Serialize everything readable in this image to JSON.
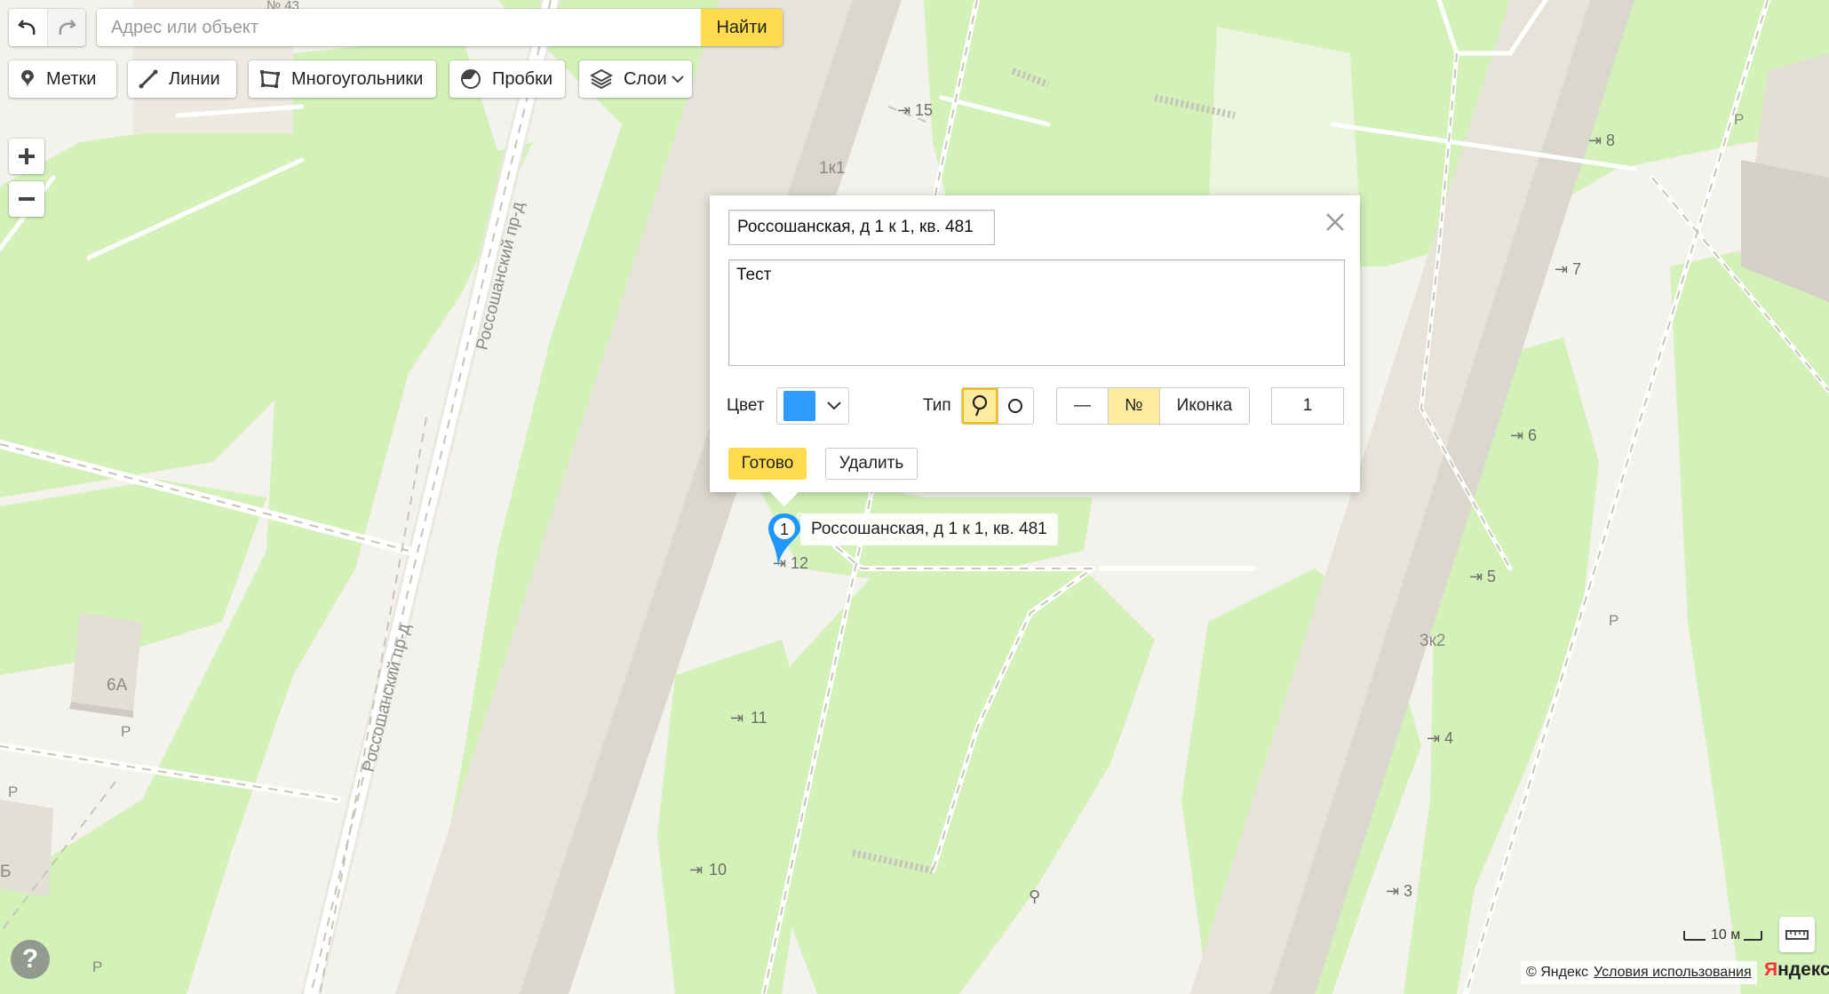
{
  "toolbar": {
    "search_placeholder": "Адрес или объект",
    "search_button": "Найти",
    "tools": [
      {
        "label": "Метки",
        "icon": "placemark-icon"
      },
      {
        "label": "Линии",
        "icon": "line-icon"
      },
      {
        "label": "Многоугольники",
        "icon": "polygon-icon"
      },
      {
        "label": "Пробки",
        "icon": "traffic-icon"
      },
      {
        "label": "Слои",
        "icon": "layers-icon"
      }
    ]
  },
  "balloon": {
    "title_value": "Россошанская, д 1 к 1, кв. 481",
    "description_value": "Тест",
    "color_label": "Цвет",
    "color_value": "#2f9bff",
    "type_label": "Тип",
    "content_options": [
      "—",
      "№",
      "Иконка"
    ],
    "selected_content": "№",
    "number_value": "1",
    "done_button": "Готово",
    "delete_button": "Удалить"
  },
  "marker": {
    "number": "1",
    "label": "Россошанская, д 1 к 1, кв. 481"
  },
  "map_labels": {
    "street_upper": "Россошанский пр-д",
    "street_lower": "Россошанский пр-д",
    "building_1k1": "1к1",
    "building_3k2": "3к2",
    "building_6a": "6А",
    "building_b": "Б",
    "top_partial": "№ 43",
    "parking": "Р",
    "entrances": [
      "15",
      "12",
      "11",
      "10",
      "8",
      "7",
      "6",
      "5",
      "4",
      "3"
    ]
  },
  "footer": {
    "scale_label": "10 м",
    "copyright": "© Яндекс",
    "terms_link": "Условия использования",
    "logo_part1": "Я",
    "logo_part2": "ндекс"
  },
  "colors": {
    "park": "#d3f1b8",
    "ground": "#f4f2ec",
    "building": "#e2dfd5",
    "accent": "#ffdb4d",
    "marker": "#1e98ff"
  }
}
